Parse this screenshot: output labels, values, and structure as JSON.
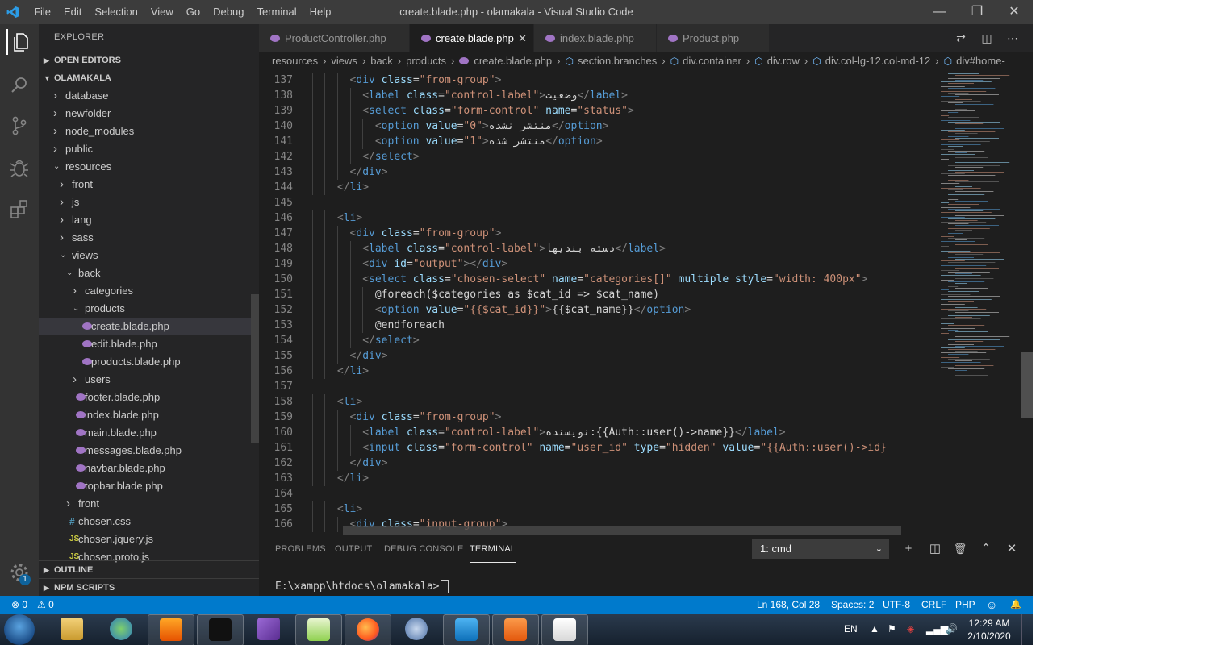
{
  "titlebar": {
    "menu": [
      "File",
      "Edit",
      "Selection",
      "View",
      "Go",
      "Debug",
      "Terminal",
      "Help"
    ],
    "title": "create.blade.php - olamakala - Visual Studio Code",
    "controls": {
      "minimize": "—",
      "restore": "❐",
      "close": "✕"
    }
  },
  "activitybar": {
    "icons": [
      "explorer-icon",
      "search-icon",
      "source-control-icon",
      "debug-icon",
      "extensions-icon"
    ],
    "manage_badge": "1"
  },
  "sidebar": {
    "title": "EXPLORER",
    "open_editors": "OPEN EDITORS",
    "project": "OLAMAKALA",
    "outline": "OUTLINE",
    "npm_scripts": "NPM SCRIPTS",
    "tree": [
      {
        "name": "database",
        "kind": "folder",
        "depth": 0,
        "open": false
      },
      {
        "name": "newfolder",
        "kind": "folder",
        "depth": 0,
        "open": false
      },
      {
        "name": "node_modules",
        "kind": "folder",
        "depth": 0,
        "open": false
      },
      {
        "name": "public",
        "kind": "folder",
        "depth": 0,
        "open": false
      },
      {
        "name": "resources",
        "kind": "folder",
        "depth": 0,
        "open": true
      },
      {
        "name": "front",
        "kind": "folder",
        "depth": 1,
        "open": false
      },
      {
        "name": "js",
        "kind": "folder",
        "depth": 1,
        "open": false
      },
      {
        "name": "lang",
        "kind": "folder",
        "depth": 1,
        "open": false
      },
      {
        "name": "sass",
        "kind": "folder",
        "depth": 1,
        "open": false
      },
      {
        "name": "views",
        "kind": "folder",
        "depth": 1,
        "open": true
      },
      {
        "name": "back",
        "kind": "folder",
        "depth": 2,
        "open": true
      },
      {
        "name": "categories",
        "kind": "folder",
        "depth": 3,
        "open": false
      },
      {
        "name": "products",
        "kind": "folder",
        "depth": 3,
        "open": true
      },
      {
        "name": "create.blade.php",
        "kind": "php",
        "depth": 4,
        "selected": true
      },
      {
        "name": "edit.blade.php",
        "kind": "php",
        "depth": 4
      },
      {
        "name": "products.blade.php",
        "kind": "php",
        "depth": 4
      },
      {
        "name": "users",
        "kind": "folder",
        "depth": 3,
        "open": false
      },
      {
        "name": "footer.blade.php",
        "kind": "php",
        "depth": 3
      },
      {
        "name": "index.blade.php",
        "kind": "php",
        "depth": 3
      },
      {
        "name": "main.blade.php",
        "kind": "php",
        "depth": 3
      },
      {
        "name": "messages.blade.php",
        "kind": "php",
        "depth": 3
      },
      {
        "name": "navbar.blade.php",
        "kind": "php",
        "depth": 3
      },
      {
        "name": "topbar.blade.php",
        "kind": "php",
        "depth": 3
      },
      {
        "name": "front",
        "kind": "folder",
        "depth": 2,
        "open": false
      },
      {
        "name": "chosen.css",
        "kind": "css",
        "depth": 2
      },
      {
        "name": "chosen.jquery.js",
        "kind": "js",
        "depth": 2
      },
      {
        "name": "chosen.proto.js",
        "kind": "js",
        "depth": 2
      }
    ]
  },
  "tabs": [
    {
      "label": "ProductController.php",
      "active": false
    },
    {
      "label": "create.blade.php",
      "active": true
    },
    {
      "label": "index.blade.php",
      "active": false
    },
    {
      "label": "Product.php",
      "active": false
    }
  ],
  "tab_actions": [
    "compare-icon",
    "split-editor-icon",
    "more-icon"
  ],
  "breadcrumb": [
    {
      "label": "resources",
      "kind": "folder"
    },
    {
      "label": "views",
      "kind": "folder"
    },
    {
      "label": "back",
      "kind": "folder"
    },
    {
      "label": "products",
      "kind": "folder"
    },
    {
      "label": "create.blade.php",
      "kind": "file"
    },
    {
      "label": "section.branches",
      "kind": "symbol"
    },
    {
      "label": "div.container",
      "kind": "symbol"
    },
    {
      "label": "div.row",
      "kind": "symbol"
    },
    {
      "label": "div.col-lg-12.col-md-12",
      "kind": "symbol"
    },
    {
      "label": "div#home-",
      "kind": "symbol"
    }
  ],
  "code": [
    {
      "n": "137",
      "indent": 8,
      "t": [
        [
          "<",
          "br"
        ],
        [
          "div",
          "tag"
        ],
        [
          " class",
          "attr"
        ],
        [
          "=",
          "txt"
        ],
        [
          "\"from-group\"",
          "str"
        ],
        [
          ">",
          "br"
        ]
      ]
    },
    {
      "n": "138",
      "indent": 10,
      "t": [
        [
          "<",
          "br"
        ],
        [
          "label",
          "tag"
        ],
        [
          " class",
          "attr"
        ],
        [
          "=",
          "txt"
        ],
        [
          "\"control-label\"",
          "str"
        ],
        [
          ">",
          "br"
        ],
        [
          "وضعیت",
          "txt"
        ],
        [
          "</",
          "br"
        ],
        [
          "label",
          "tag"
        ],
        [
          ">",
          "br"
        ]
      ]
    },
    {
      "n": "139",
      "indent": 10,
      "t": [
        [
          "<",
          "br"
        ],
        [
          "select",
          "tag"
        ],
        [
          " class",
          "attr"
        ],
        [
          "=",
          "txt"
        ],
        [
          "\"form-control\"",
          "str"
        ],
        [
          " name",
          "attr"
        ],
        [
          "=",
          "txt"
        ],
        [
          "\"status\"",
          "str"
        ],
        [
          ">",
          "br"
        ]
      ]
    },
    {
      "n": "140",
      "indent": 12,
      "t": [
        [
          "<",
          "br"
        ],
        [
          "option",
          "tag"
        ],
        [
          " value",
          "attr"
        ],
        [
          "=",
          "txt"
        ],
        [
          "\"0\"",
          "str"
        ],
        [
          ">",
          "br"
        ],
        [
          "منتشر نشده",
          "txt"
        ],
        [
          "</",
          "br"
        ],
        [
          "option",
          "tag"
        ],
        [
          ">",
          "br"
        ]
      ]
    },
    {
      "n": "141",
      "indent": 12,
      "t": [
        [
          "<",
          "br"
        ],
        [
          "option",
          "tag"
        ],
        [
          " value",
          "attr"
        ],
        [
          "=",
          "txt"
        ],
        [
          "\"1\"",
          "str"
        ],
        [
          ">",
          "br"
        ],
        [
          "منتشر شده",
          "txt"
        ],
        [
          "</",
          "br"
        ],
        [
          "option",
          "tag"
        ],
        [
          ">",
          "br"
        ]
      ]
    },
    {
      "n": "142",
      "indent": 10,
      "t": [
        [
          "</",
          "br"
        ],
        [
          "select",
          "tag"
        ],
        [
          ">",
          "br"
        ]
      ]
    },
    {
      "n": "143",
      "indent": 8,
      "t": [
        [
          "</",
          "br"
        ],
        [
          "div",
          "tag"
        ],
        [
          ">",
          "br"
        ]
      ]
    },
    {
      "n": "144",
      "indent": 6,
      "t": [
        [
          "</",
          "br"
        ],
        [
          "li",
          "tag"
        ],
        [
          ">",
          "br"
        ]
      ]
    },
    {
      "n": "145",
      "indent": 0,
      "t": []
    },
    {
      "n": "146",
      "indent": 6,
      "t": [
        [
          "<",
          "br"
        ],
        [
          "li",
          "tag"
        ],
        [
          ">",
          "br"
        ]
      ]
    },
    {
      "n": "147",
      "indent": 8,
      "t": [
        [
          "<",
          "br"
        ],
        [
          "div",
          "tag"
        ],
        [
          " class",
          "attr"
        ],
        [
          "=",
          "txt"
        ],
        [
          "\"from-group\"",
          "str"
        ],
        [
          ">",
          "br"
        ]
      ]
    },
    {
      "n": "148",
      "indent": 10,
      "t": [
        [
          "<",
          "br"
        ],
        [
          "label",
          "tag"
        ],
        [
          " class",
          "attr"
        ],
        [
          "=",
          "txt"
        ],
        [
          "\"control-label\"",
          "str"
        ],
        [
          ">",
          "br"
        ],
        [
          "دسته بندیها",
          "txt"
        ],
        [
          "</",
          "br"
        ],
        [
          "label",
          "tag"
        ],
        [
          ">",
          "br"
        ]
      ]
    },
    {
      "n": "149",
      "indent": 10,
      "t": [
        [
          "<",
          "br"
        ],
        [
          "div",
          "tag"
        ],
        [
          " id",
          "attr"
        ],
        [
          "=",
          "txt"
        ],
        [
          "\"output\"",
          "str"
        ],
        [
          "></",
          "br"
        ],
        [
          "div",
          "tag"
        ],
        [
          ">",
          "br"
        ]
      ]
    },
    {
      "n": "150",
      "indent": 10,
      "t": [
        [
          "<",
          "br"
        ],
        [
          "select",
          "tag"
        ],
        [
          " class",
          "attr"
        ],
        [
          "=",
          "txt"
        ],
        [
          "\"chosen-select\"",
          "str"
        ],
        [
          " name",
          "attr"
        ],
        [
          "=",
          "txt"
        ],
        [
          "\"categories[]\"",
          "str"
        ],
        [
          " multiple",
          "attr"
        ],
        [
          " style",
          "attr"
        ],
        [
          "=",
          "txt"
        ],
        [
          "\"width: 400px\"",
          "str"
        ],
        [
          ">",
          "br"
        ]
      ]
    },
    {
      "n": "151",
      "indent": 12,
      "t": [
        [
          "@foreach($categories as $cat_id => $cat_name)",
          "txt"
        ]
      ]
    },
    {
      "n": "152",
      "indent": 12,
      "t": [
        [
          "<",
          "br"
        ],
        [
          "option",
          "tag"
        ],
        [
          " value",
          "attr"
        ],
        [
          "=",
          "txt"
        ],
        [
          "\"{{$cat_id}}\"",
          "str"
        ],
        [
          ">",
          "br"
        ],
        [
          "{{$cat_name}}",
          "txt"
        ],
        [
          "</",
          "br"
        ],
        [
          "option",
          "tag"
        ],
        [
          ">",
          "br"
        ]
      ]
    },
    {
      "n": "153",
      "indent": 12,
      "t": [
        [
          "@endforeach",
          "txt"
        ]
      ]
    },
    {
      "n": "154",
      "indent": 10,
      "t": [
        [
          "</",
          "br"
        ],
        [
          "select",
          "tag"
        ],
        [
          ">",
          "br"
        ]
      ]
    },
    {
      "n": "155",
      "indent": 8,
      "t": [
        [
          "</",
          "br"
        ],
        [
          "div",
          "tag"
        ],
        [
          ">",
          "br"
        ]
      ]
    },
    {
      "n": "156",
      "indent": 6,
      "t": [
        [
          "</",
          "br"
        ],
        [
          "li",
          "tag"
        ],
        [
          ">",
          "br"
        ]
      ]
    },
    {
      "n": "157",
      "indent": 0,
      "t": []
    },
    {
      "n": "158",
      "indent": 6,
      "t": [
        [
          "<",
          "br"
        ],
        [
          "li",
          "tag"
        ],
        [
          ">",
          "br"
        ]
      ]
    },
    {
      "n": "159",
      "indent": 8,
      "t": [
        [
          "<",
          "br"
        ],
        [
          "div",
          "tag"
        ],
        [
          " class",
          "attr"
        ],
        [
          "=",
          "txt"
        ],
        [
          "\"from-group\"",
          "str"
        ],
        [
          ">",
          "br"
        ]
      ]
    },
    {
      "n": "160",
      "indent": 10,
      "t": [
        [
          "<",
          "br"
        ],
        [
          "label",
          "tag"
        ],
        [
          " class",
          "attr"
        ],
        [
          "=",
          "txt"
        ],
        [
          "\"control-label\"",
          "str"
        ],
        [
          ">",
          "br"
        ],
        [
          "نویسنده:{{Auth::user()->name}}",
          "txt"
        ],
        [
          "</",
          "br"
        ],
        [
          "label",
          "tag"
        ],
        [
          ">",
          "br"
        ]
      ]
    },
    {
      "n": "161",
      "indent": 10,
      "t": [
        [
          "<",
          "br"
        ],
        [
          "input",
          "tag"
        ],
        [
          " class",
          "attr"
        ],
        [
          "=",
          "txt"
        ],
        [
          "\"form-control\"",
          "str"
        ],
        [
          " name",
          "attr"
        ],
        [
          "=",
          "txt"
        ],
        [
          "\"user_id\"",
          "str"
        ],
        [
          " type",
          "attr"
        ],
        [
          "=",
          "txt"
        ],
        [
          "\"hidden\"",
          "str"
        ],
        [
          " value",
          "attr"
        ],
        [
          "=",
          "txt"
        ],
        [
          "\"{{Auth::user()->id}",
          "str"
        ]
      ]
    },
    {
      "n": "162",
      "indent": 8,
      "t": [
        [
          "</",
          "br"
        ],
        [
          "div",
          "tag"
        ],
        [
          ">",
          "br"
        ]
      ]
    },
    {
      "n": "163",
      "indent": 6,
      "t": [
        [
          "</",
          "br"
        ],
        [
          "li",
          "tag"
        ],
        [
          ">",
          "br"
        ]
      ]
    },
    {
      "n": "164",
      "indent": 0,
      "t": []
    },
    {
      "n": "165",
      "indent": 6,
      "t": [
        [
          "<",
          "br"
        ],
        [
          "li",
          "tag"
        ],
        [
          ">",
          "br"
        ]
      ]
    },
    {
      "n": "166",
      "indent": 8,
      "t": [
        [
          "<",
          "br"
        ],
        [
          "div",
          "tag"
        ],
        [
          " class",
          "attr"
        ],
        [
          "=",
          "txt"
        ],
        [
          "\"input-group\"",
          "str"
        ],
        [
          ">",
          "br"
        ]
      ]
    }
  ],
  "panel": {
    "tabs": [
      {
        "label": "PROBLEMS",
        "active": false
      },
      {
        "label": "OUTPUT",
        "active": false
      },
      {
        "label": "DEBUG CONSOLE",
        "active": false
      },
      {
        "label": "TERMINAL",
        "active": true
      }
    ],
    "terminal_select": "1: cmd",
    "actions": {
      "new": "+",
      "split": "◫",
      "kill": "🗑",
      "maximize": "⌃",
      "close": "✕"
    },
    "prompt": "E:\\xampp\\htdocs\\olamakala>"
  },
  "statusbar": {
    "errors": "⊗ 0",
    "warnings": "⚠ 0",
    "position": "Ln 168, Col 28",
    "spaces": "Spaces: 2",
    "encoding": "UTF-8",
    "eol": "CRLF",
    "language": "PHP",
    "feedback": "☺",
    "bell": "🔔"
  },
  "taskbar": {
    "apps": [
      "file-explorer",
      "internet-download-manager",
      "sublime-text",
      "command-prompt",
      "visual-studio",
      "notepad-plus-plus",
      "firefox",
      "browser",
      "vscode",
      "xampp",
      "paint"
    ],
    "lang": "EN",
    "time": "12:29 AM",
    "date": "2/10/2020"
  },
  "colors": {
    "accent": "#007acc",
    "activity": "#333333",
    "sidebar": "#252526",
    "editor": "#1e1e1e",
    "titlebar": "#3c3c3c"
  }
}
